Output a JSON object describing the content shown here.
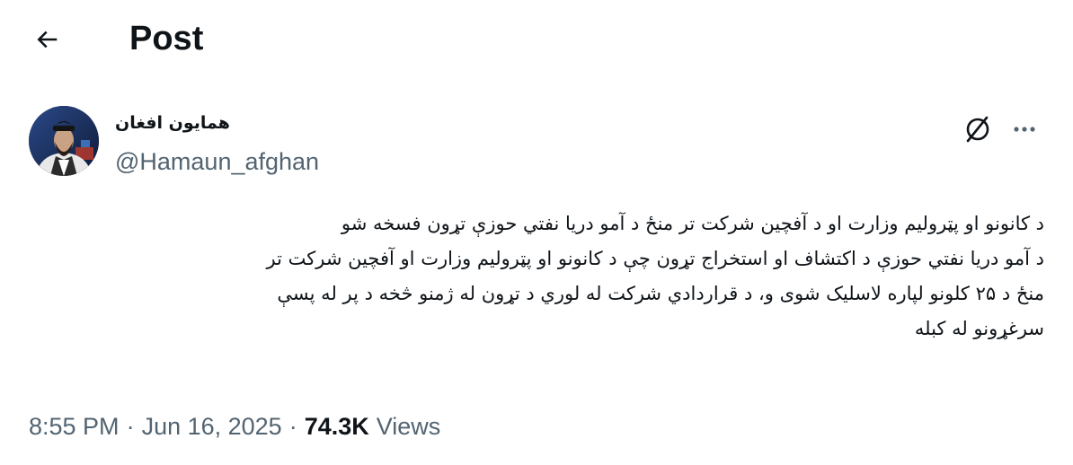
{
  "header": {
    "back_icon": "arrow-left-icon",
    "title": "Post"
  },
  "author": {
    "display_name": "همايون افغان",
    "handle": "@Hamaun_afghan",
    "avatar_icon": "avatar-photo"
  },
  "actions": {
    "grok_icon": "grok-icon",
    "more_icon": "more-horizontal-icon"
  },
  "tweet": {
    "lines": [
      "د کانونو او پټرولیم وزارت او د آفچین شرکت تر منځ د آمو دریا نفتي حوزې تړون فسخه شو",
      "د آمو دریا نفتي حوزې د اکتشاف او استخراج تړون چې د کانونو او پټرولیم وزارت او آفچین شرکت تر",
      "منځ د ۲۵ کلونو لپاره لاسلیک شوی و، د قراردادي شرکت له لوري د تړون له ژمنو څخه د پر له پسې",
      "سرغړونو له کبله"
    ]
  },
  "meta": {
    "time": "8:55 PM",
    "date": "Jun 16, 2025",
    "separator": "·",
    "views_count": "74.3K",
    "views_label": "Views"
  },
  "colors": {
    "text_primary": "#0f1419",
    "text_secondary": "#536471",
    "background": "#ffffff"
  }
}
